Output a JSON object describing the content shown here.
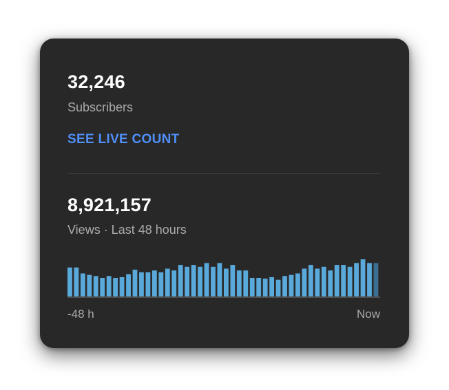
{
  "subscribers": {
    "count": "32,246",
    "label": "Subscribers",
    "live_link": "SEE LIVE COUNT"
  },
  "views": {
    "count": "8,921,157",
    "label": "Views · Last 48 hours"
  },
  "colors": {
    "card_bg": "#282828",
    "accent_link": "#4f8ff7",
    "bar": "#5aa9db",
    "bar_current": "#3b6f92"
  },
  "chart_data": {
    "type": "bar",
    "title": "",
    "xlabel": "",
    "ylabel": "",
    "x_tick_labels": [
      "-48 h",
      "Now"
    ],
    "categories": [
      "1",
      "2",
      "3",
      "4",
      "5",
      "6",
      "7",
      "8",
      "9",
      "10",
      "11",
      "12",
      "13",
      "14",
      "15",
      "16",
      "17",
      "18",
      "19",
      "20",
      "21",
      "22",
      "23",
      "24",
      "25",
      "26",
      "27",
      "28",
      "29",
      "30",
      "31",
      "32",
      "33",
      "34",
      "35",
      "36",
      "37",
      "38",
      "39",
      "40",
      "41",
      "42",
      "43",
      "44",
      "45",
      "46",
      "47",
      "48"
    ],
    "values": [
      0.78,
      0.78,
      0.62,
      0.58,
      0.55,
      0.5,
      0.55,
      0.5,
      0.52,
      0.6,
      0.72,
      0.65,
      0.65,
      0.7,
      0.65,
      0.75,
      0.7,
      0.85,
      0.8,
      0.85,
      0.8,
      0.9,
      0.8,
      0.9,
      0.75,
      0.85,
      0.7,
      0.7,
      0.5,
      0.5,
      0.48,
      0.52,
      0.45,
      0.55,
      0.58,
      0.62,
      0.75,
      0.85,
      0.75,
      0.8,
      0.7,
      0.85,
      0.85,
      0.8,
      0.9,
      1.0,
      0.9,
      0.9
    ],
    "ylim": [
      0,
      1
    ],
    "grid": false
  }
}
